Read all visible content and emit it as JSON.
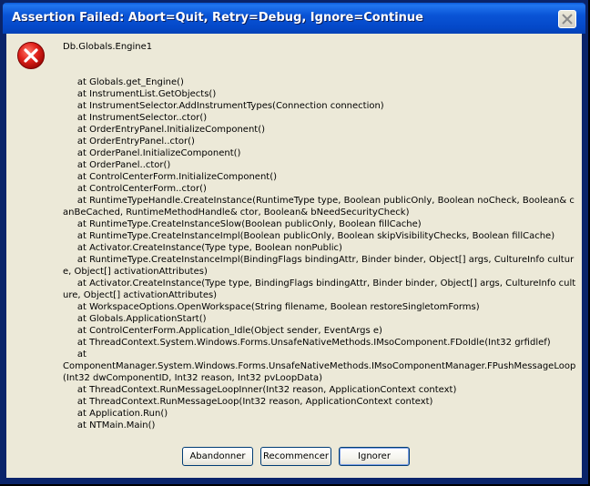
{
  "window": {
    "title": "Assertion Failed: Abort=Quit, Retry=Debug, Ignore=Continue"
  },
  "icons": {
    "error": "error-icon",
    "close": "close-icon"
  },
  "message": {
    "text": "Db.Globals.Engine1\n\n\n     at Globals.get_Engine()\n     at InstrumentList.GetObjects()\n     at InstrumentSelector.AddInstrumentTypes(Connection connection)\n     at InstrumentSelector..ctor()\n     at OrderEntryPanel.InitializeComponent()\n     at OrderEntryPanel..ctor()\n     at OrderPanel.InitializeComponent()\n     at OrderPanel..ctor()\n     at ControlCenterForm.InitializeComponent()\n     at ControlCenterForm..ctor()\n     at RuntimeTypeHandle.CreateInstance(RuntimeType type, Boolean publicOnly, Boolean noCheck, Boolean& canBeCached, RuntimeMethodHandle& ctor, Boolean& bNeedSecurityCheck)\n     at RuntimeType.CreateInstanceSlow(Boolean publicOnly, Boolean fillCache)\n     at RuntimeType.CreateInstanceImpl(Boolean publicOnly, Boolean skipVisibilityChecks, Boolean fillCache)\n     at Activator.CreateInstance(Type type, Boolean nonPublic)\n     at RuntimeType.CreateInstanceImpl(BindingFlags bindingAttr, Binder binder, Object[] args, CultureInfo culture, Object[] activationAttributes)\n     at Activator.CreateInstance(Type type, BindingFlags bindingAttr, Binder binder, Object[] args, CultureInfo culture, Object[] activationAttributes)\n     at WorkspaceOptions.OpenWorkspace(String filename, Boolean restoreSingletomForms)\n     at Globals.ApplicationStart()\n     at ControlCenterForm.Application_Idle(Object sender, EventArgs e)\n     at ThreadContext.System.Windows.Forms.UnsafeNativeMethods.IMsoComponent.FDoIdle(Int32 grfidlef)\n     at\nComponentManager.System.Windows.Forms.UnsafeNativeMethods.IMsoComponentManager.FPushMessageLoop(Int32 dwComponentID, Int32 reason, Int32 pvLoopData)\n     at ThreadContext.RunMessageLoopInner(Int32 reason, ApplicationContext context)\n     at ThreadContext.RunMessageLoop(Int32 reason, ApplicationContext context)\n     at Application.Run()\n     at NTMain.Main()"
  },
  "buttons": {
    "abort": "Abandonner",
    "retry": "Recommencer",
    "ignore": "Ignorer"
  }
}
